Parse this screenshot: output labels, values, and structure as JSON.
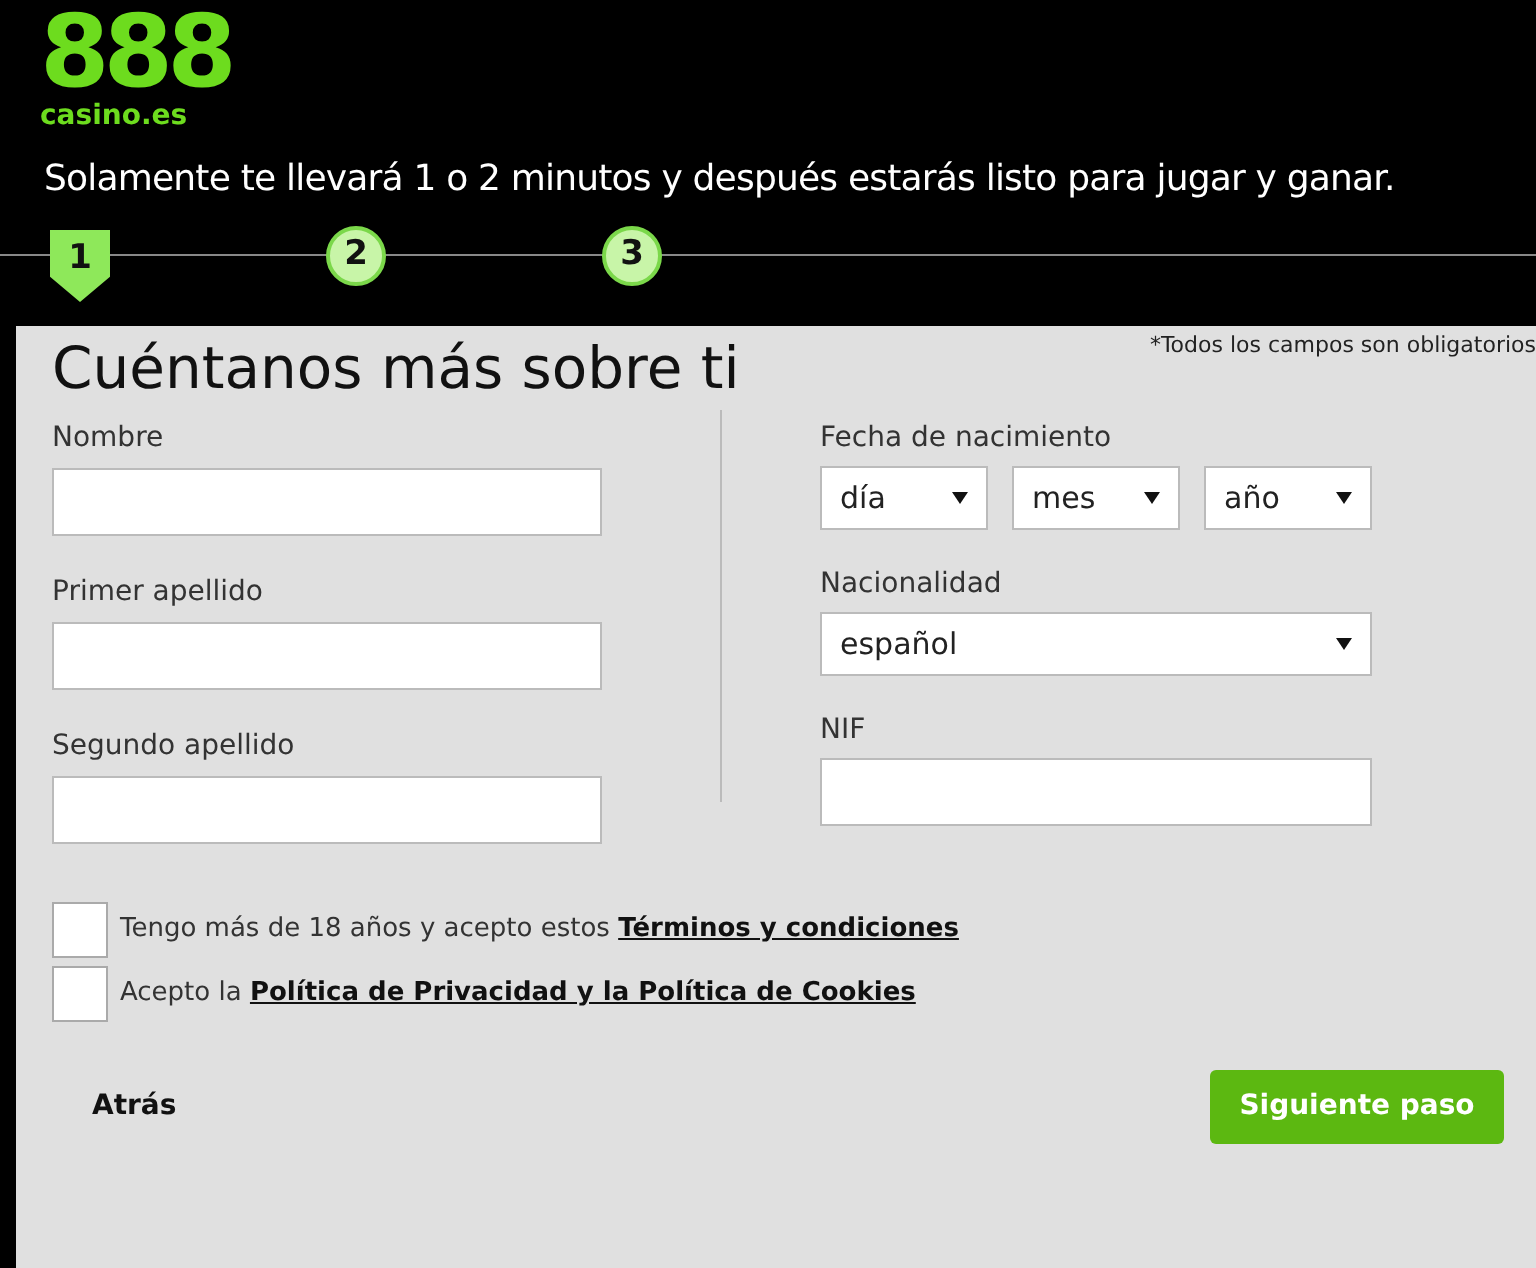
{
  "logo": {
    "mark": "888",
    "domain": "casino.es"
  },
  "intro": "Solamente te llevará 1 o 2 minutos y después estarás listo para jugar y ganar.",
  "steps": [
    {
      "label": "1",
      "selected": true
    },
    {
      "label": "2",
      "selected": false
    },
    {
      "label": "3",
      "selected": false
    }
  ],
  "required_note": "*Todos los campos son obligatorios",
  "title": "Cuéntanos más sobre ti",
  "left_fields": [
    {
      "label": "Nombre"
    },
    {
      "label": "Primer apellido"
    },
    {
      "label": "Segundo apellido"
    }
  ],
  "birth": {
    "label": "Fecha de nacimiento",
    "selects": [
      "día",
      "mes",
      "año"
    ]
  },
  "nationality": {
    "label": "Nacionalidad",
    "value": "español"
  },
  "nif": {
    "label": "NIF"
  },
  "consents": [
    {
      "text": "Tengo más de 18 años y acepto estos ",
      "link": "Términos y condiciones",
      "checked": false
    },
    {
      "text": "Acepto la ",
      "link": "Política de Privacidad y la Política de Cookies",
      "checked": false
    }
  ],
  "back": "Atrás",
  "next": "Siguiente paso"
}
